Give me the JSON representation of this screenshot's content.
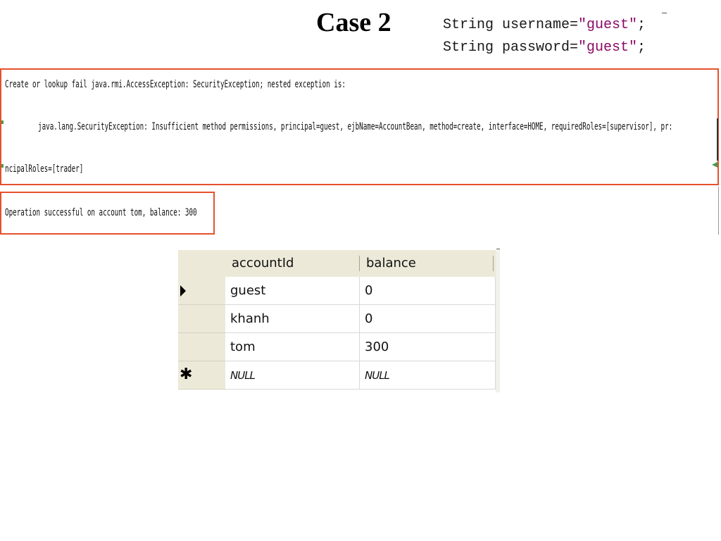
{
  "slide": {
    "title": "Case 2"
  },
  "code": {
    "line1_prefix": "String username=",
    "line1_string": "\"guest\"",
    "line1_suffix": ";",
    "line2_prefix": "String password=",
    "line2_string": "\"guest\"",
    "line2_suffix": ";"
  },
  "console_error": {
    "line1": "Create or lookup fail java.rmi.AccessException: SecurityException; nested exception is:",
    "line2": "java.lang.SecurityException: Insufficient method permissions, principal=guest, ejbName=AccountBean, method=create, interface=HOME, requiredRoles=[supervisor], pr:",
    "line3": "ncipalRoles=[trader]"
  },
  "console_ok": {
    "line1": "Operation successful on account tom, balance: 300"
  },
  "grid": {
    "columns": [
      "accountId",
      "balance"
    ],
    "rows": [
      {
        "indicator": "current",
        "accountId": "guest",
        "balance": "0"
      },
      {
        "indicator": "",
        "accountId": "khanh",
        "balance": "0"
      },
      {
        "indicator": "",
        "accountId": "tom",
        "balance": "300"
      },
      {
        "indicator": "new",
        "accountId": "NULL",
        "balance": "NULL"
      }
    ],
    "new_row_symbol": "✱"
  },
  "colors": {
    "box_border": "#e5512b",
    "code_string": "#8b0a65",
    "grid_header_bg": "#ece9d8"
  },
  "icons": {
    "current_row": "row-pointer-icon",
    "new_row": "new-row-star-icon",
    "scroll": "scroll-arrow-icon"
  }
}
